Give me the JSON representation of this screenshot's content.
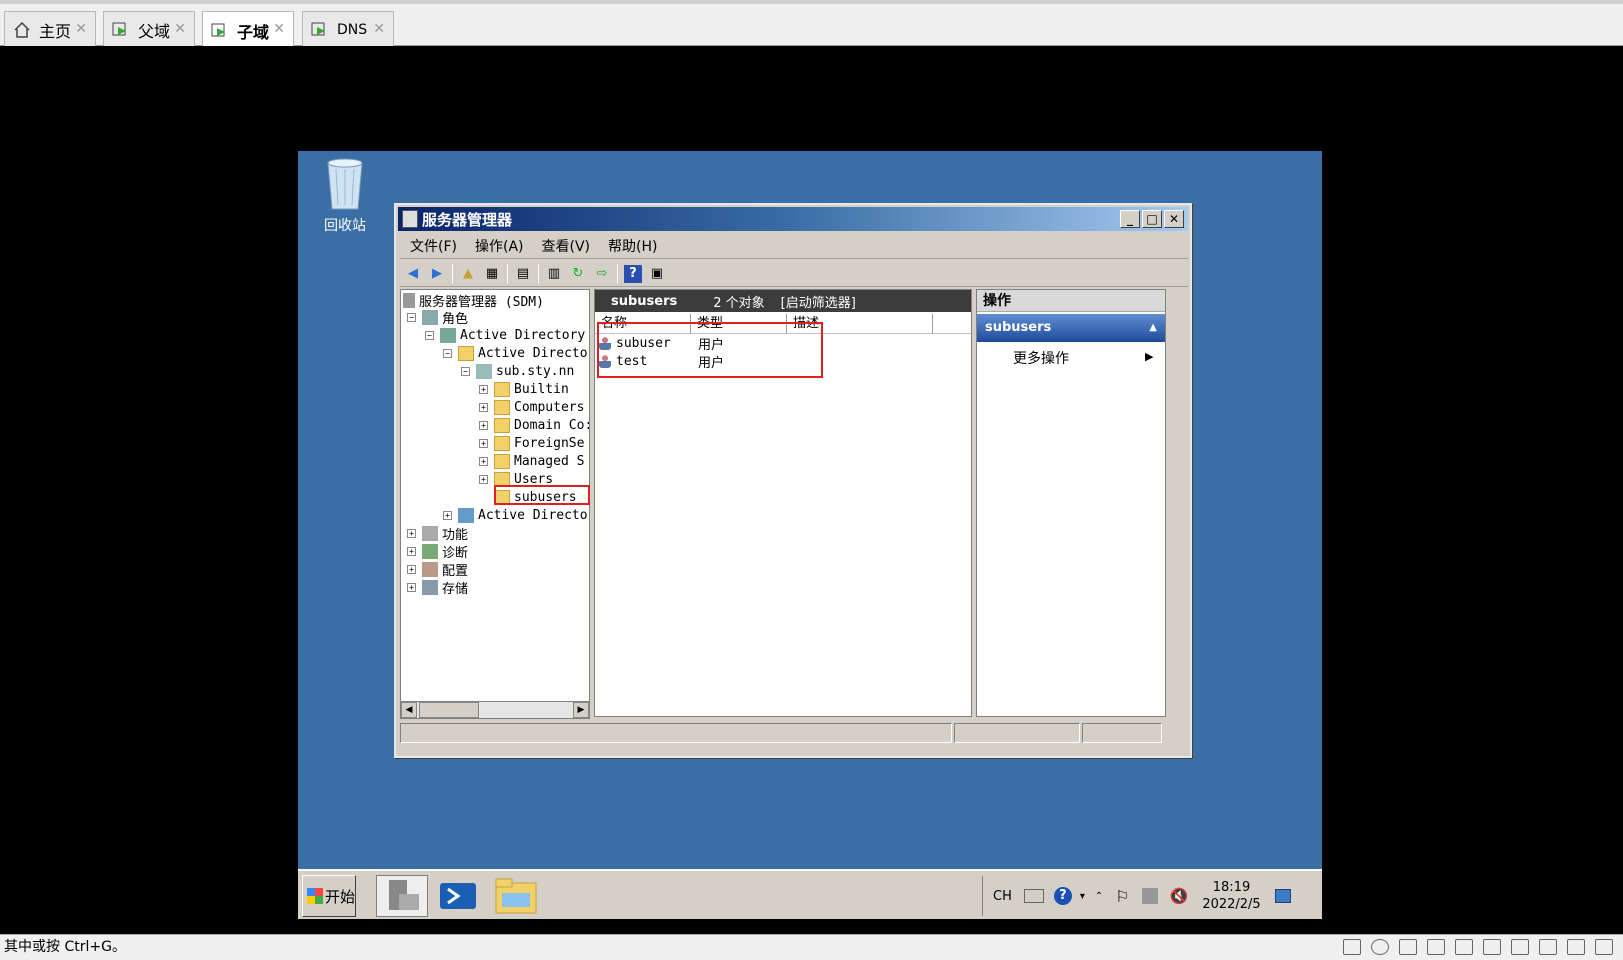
{
  "tabs": [
    {
      "label": "主页",
      "icon": "home-icon"
    },
    {
      "label": "父域",
      "icon": "vm-icon"
    },
    {
      "label": "子域",
      "icon": "vm-icon",
      "active": true
    },
    {
      "label": "DNS",
      "icon": "vm-icon"
    }
  ],
  "tab_close": "✕",
  "desktop": {
    "recycle_bin_label": "回收站"
  },
  "window": {
    "title": "服务器管理器",
    "minimize": "_",
    "maximize": "□",
    "close": "✕",
    "menu": [
      "文件(F)",
      "操作(A)",
      "查看(V)",
      "帮助(H)"
    ],
    "tree": {
      "root": "服务器管理器 (SDM)",
      "roles": "角色",
      "ad_ds": "Active Directory",
      "ad_users": "Active Directo",
      "domain": "sub.sty.nn",
      "ous": [
        "Builtin",
        "Computers",
        "Domain Co:",
        "ForeignSe",
        "Managed S",
        "Users"
      ],
      "selected": "subusers",
      "ad_other": "Active Directo",
      "features": "功能",
      "diagnostics": "诊断",
      "configuration": "配置",
      "storage": "存储"
    },
    "list": {
      "header_name": "subusers",
      "header_count": "2 个对象",
      "header_filter": "[启动筛选器]",
      "columns": [
        "名称",
        "类型",
        "描述"
      ],
      "rows": [
        {
          "name": "subuser",
          "type": "用户"
        },
        {
          "name": "test",
          "type": "用户"
        }
      ]
    },
    "actions": {
      "title": "操作",
      "selected": "subusers",
      "more": "更多操作"
    }
  },
  "taskbar": {
    "start": "开始",
    "lang": "CH",
    "time": "18:19",
    "date": "2022/2/5"
  },
  "status_hint": "其中或按 Ctrl+G。",
  "colors": {
    "desktop": "#3a6ea5",
    "highlight": "#e02020",
    "action_selected": "#1f4a9c"
  }
}
